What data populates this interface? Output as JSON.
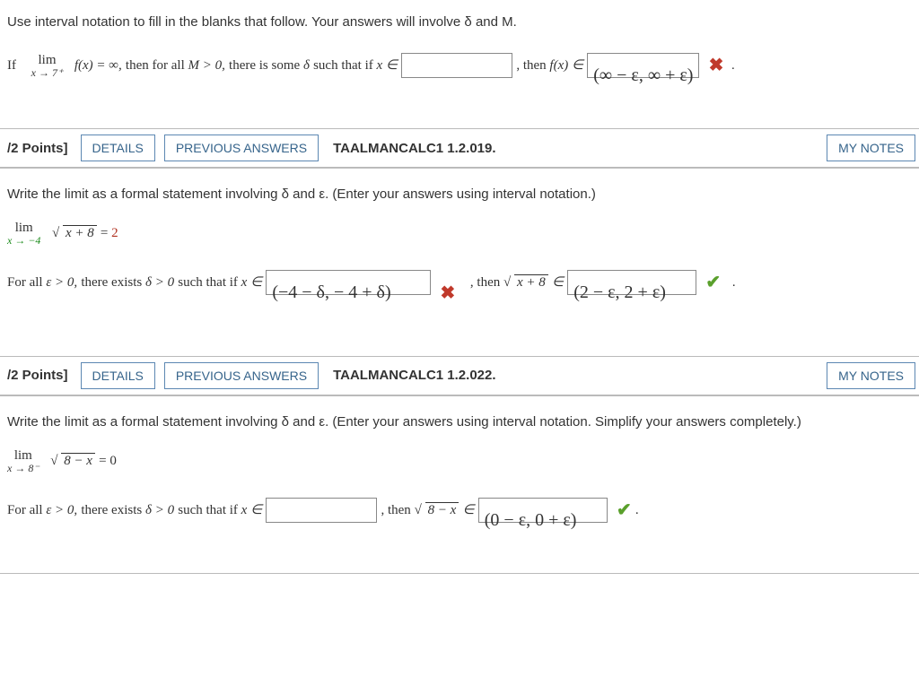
{
  "q1": {
    "instr": "Use interval notation to fill in the blanks that follow. Your answers will involve δ and M.",
    "line_pre_if": "If",
    "lim_label": "lim",
    "lim_sub": "x → 7⁺",
    "lim_expr": "f(x) = ∞,",
    "mid1": " then for all ",
    "M_gt": "M > 0,",
    "mid2": " there is some ",
    "delta": "δ",
    "mid3": " such that if ",
    "xin": "x ∈",
    "ans1": "",
    "comma": " ,  then ",
    "fxin": "f(x) ∈",
    "ans2": "(∞ − ε, ∞ + ε)",
    "mark": "✖"
  },
  "hdr2": {
    "points": "/2 Points]",
    "details": "DETAILS",
    "prev": "PREVIOUS ANSWERS",
    "ref": "TAALMANCALC1 1.2.019.",
    "notes": "MY NOTES"
  },
  "q2": {
    "instr": "Write the limit as a formal statement involving δ and ε. (Enter your answers using interval notation.)",
    "lim_label": "lim",
    "lim_sub": "x → −4",
    "sqrt_inner": "x + 8",
    "eq": " = ",
    "rhs": "2",
    "line2_pre": "For all ",
    "eps": "ε > 0,",
    "mid1": " there exists ",
    "dgt": "δ > 0",
    "mid2": " such that if ",
    "xin": "x ∈",
    "ans1": "(−4 − δ, − 4 + δ)",
    "mark1": "✖",
    "comma": " ,  then ",
    "sqrt2_inner": "x + 8",
    "in": " ∈",
    "ans2": "(2 − ε, 2 + ε)",
    "mark2": "✔"
  },
  "hdr3": {
    "points": "/2 Points]",
    "details": "DETAILS",
    "prev": "PREVIOUS ANSWERS",
    "ref": "TAALMANCALC1 1.2.022.",
    "notes": "MY NOTES"
  },
  "q3": {
    "instr": "Write the limit as a formal statement involving δ and ε. (Enter your answers using interval notation. Simplify your answers completely.)",
    "lim_label": "lim",
    "lim_sub": "x → 8⁻",
    "sqrt_inner": "8 − x",
    "eq": " = ",
    "rhs": "0",
    "line2_pre": "For all ",
    "eps": "ε > 0,",
    "mid1": " there exists ",
    "dgt": "δ > 0",
    "mid2": " such that if ",
    "xin": "x ∈",
    "ans1": "",
    "comma": " ,  then ",
    "sqrt2_inner": "8 − x",
    "in": " ∈",
    "ans2": "(0 − ε, 0 + ε)",
    "mark2": "✔",
    "period": " ."
  }
}
